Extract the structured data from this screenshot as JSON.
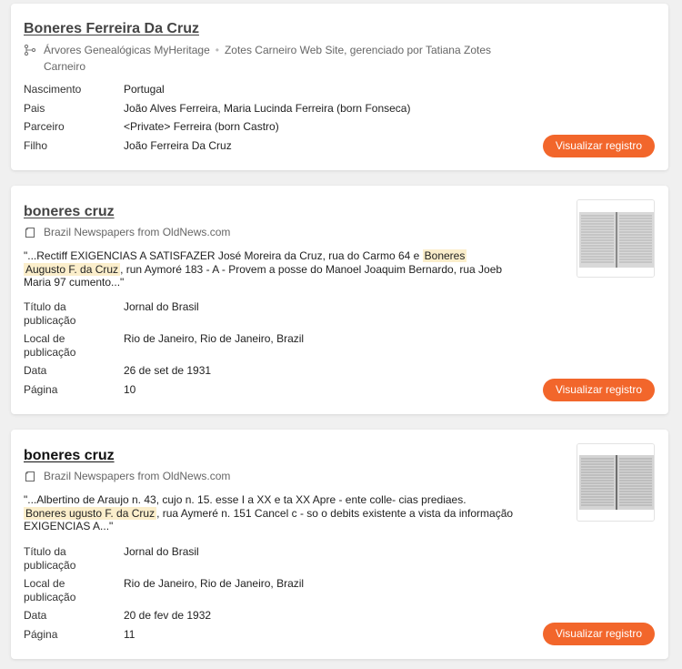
{
  "cards": [
    {
      "title": "Boneres Ferreira Da Cruz",
      "source_icon": "family-tree-icon",
      "source_part1": "Árvores Genealógicas MyHeritage",
      "source_part2": "Zotes Carneiro Web Site, gerenciado por Tatiana Zotes",
      "source_part3": "Carneiro",
      "fields": [
        {
          "label": "Nascimento",
          "value": "Portugal"
        },
        {
          "label": "Pais",
          "value": "João Alves Ferreira, Maria Lucinda Ferreira (born Fonseca)"
        },
        {
          "label": "Parceiro",
          "value": "<Private> Ferreira (born Castro)"
        },
        {
          "label": "Filho",
          "value": "João Ferreira Da Cruz"
        }
      ],
      "button": "Visualizar registro"
    },
    {
      "title": "boneres cruz",
      "source_icon": "newspaper-icon",
      "source": "Brazil Newspapers from OldNews.com",
      "snippet_pre": "\"...Rectiff EXIGENCIAS A SATISFAZER José Moreira da Cruz, rua do Carmo 64 e ",
      "snippet_hl1": "Boneres",
      "snippet_hl2": "Augusto F. da Cruz",
      "snippet_post": ", run Aymoré 183 - A - Provem a posse do Manoel Joaquim Bernardo, rua Joeb Maria 97 cumento...\"",
      "fields": [
        {
          "label": "Título da publicação",
          "value": "Jornal do Brasil"
        },
        {
          "label": "Local de publicação",
          "value": "Rio de Janeiro, Rio de Janeiro, Brazil"
        },
        {
          "label": "Data",
          "value": "26 de set de 1931"
        },
        {
          "label": "Página",
          "value": "10"
        }
      ],
      "button": "Visualizar registro"
    },
    {
      "title": "boneres cruz",
      "source_icon": "newspaper-icon",
      "source": "Brazil Newspapers from OldNews.com",
      "snippet_pre": "\"...Albertino de Araujo n. 43, cujo n. 15. esse I a XX e ta XX Apre - ente colle- cias prediaes. ",
      "snippet_hl1": "Boneres ugusto F. da Cruz",
      "snippet_post": ", rua Aymeré n. 151 Cancel c - so o debits existente a vista da informação EXIGENCIAS A...\"",
      "fields": [
        {
          "label": "Título da publicação",
          "value": "Jornal do Brasil"
        },
        {
          "label": "Local de publicação",
          "value": "Rio de Janeiro, Rio de Janeiro, Brazil"
        },
        {
          "label": "Data",
          "value": "20 de fev de 1932"
        },
        {
          "label": "Página",
          "value": "11"
        }
      ],
      "button": "Visualizar registro"
    }
  ],
  "colors": {
    "accent": "#f2662b",
    "highlight": "#fbeecb",
    "background": "#f0f0f0"
  }
}
